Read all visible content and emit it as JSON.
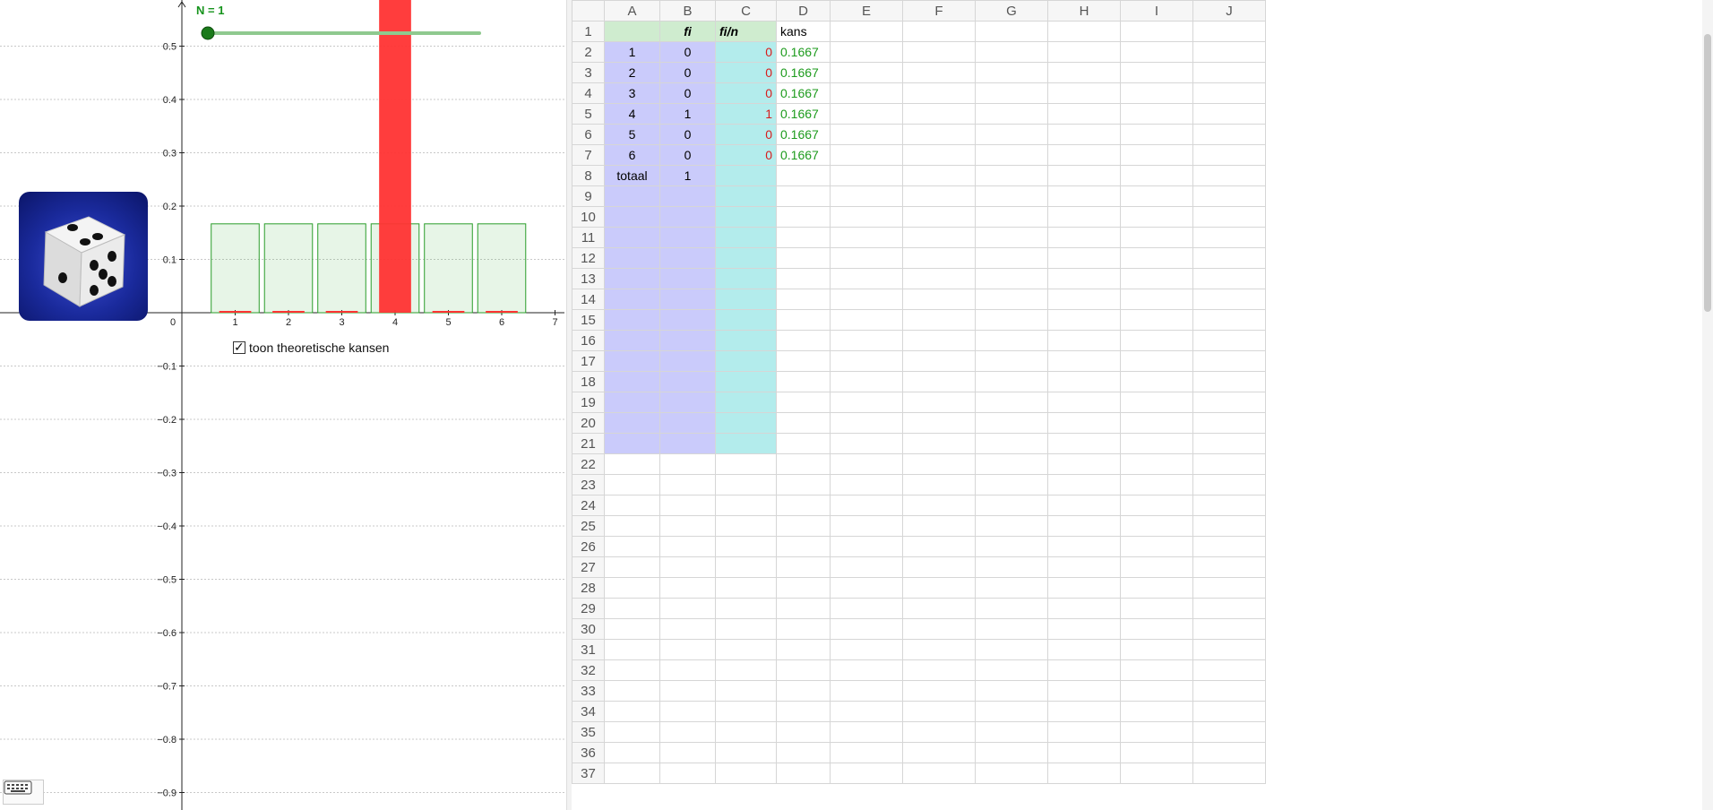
{
  "graphics": {
    "slider_label": "N = 1",
    "slider_value": 1,
    "checkbox_label": "toon theoretische kansen",
    "checkbox_checked": true
  },
  "chart_data": {
    "type": "bar",
    "x_tick_labels": [
      "0",
      "1",
      "2",
      "3",
      "4",
      "5",
      "6",
      "7"
    ],
    "y_tick_labels": [
      "0.5",
      "0.4",
      "0.3",
      "0.2",
      "0.1",
      "−0.1",
      "−0.2",
      "−0.3",
      "−0.4",
      "−0.5",
      "−0.6",
      "−0.7",
      "−0.8",
      "−0.9"
    ],
    "categories": [
      1,
      2,
      3,
      4,
      5,
      6
    ],
    "series": [
      {
        "values": [
          0,
          0,
          0,
          1,
          0,
          0
        ],
        "color": "#ff3333"
      },
      {
        "values": [
          0.1667,
          0.1667,
          0.1667,
          0.1667,
          0.1667,
          0.1667
        ],
        "color": "#2a9d2a"
      }
    ],
    "xlim": [
      0,
      7
    ],
    "grid": true
  },
  "sheet": {
    "columns": [
      "A",
      "B",
      "C",
      "D",
      "E",
      "F",
      "G",
      "H",
      "I",
      "J"
    ],
    "header_row": {
      "A": "",
      "B": "fi",
      "C": "fi/n",
      "D": "kans"
    },
    "data_rows": [
      {
        "A": "1",
        "B": "0",
        "C": "0",
        "D": "0.1667"
      },
      {
        "A": "2",
        "B": "0",
        "C": "0",
        "D": "0.1667"
      },
      {
        "A": "3",
        "B": "0",
        "C": "0",
        "D": "0.1667"
      },
      {
        "A": "4",
        "B": "1",
        "C": "1",
        "D": "0.1667"
      },
      {
        "A": "5",
        "B": "0",
        "C": "0",
        "D": "0.1667"
      },
      {
        "A": "6",
        "B": "0",
        "C": "0",
        "D": "0.1667"
      }
    ],
    "total_row": {
      "A": "totaal",
      "B": "1",
      "C": "",
      "D": ""
    },
    "row_count": 37,
    "shaded_rows_last": 21
  },
  "colors": {
    "colAB": "#cacbfb",
    "colC": "#b3ecec",
    "header_green": "#cfeccf",
    "red_bar": "#ff3333",
    "green_bar": "#2a9d2a"
  }
}
